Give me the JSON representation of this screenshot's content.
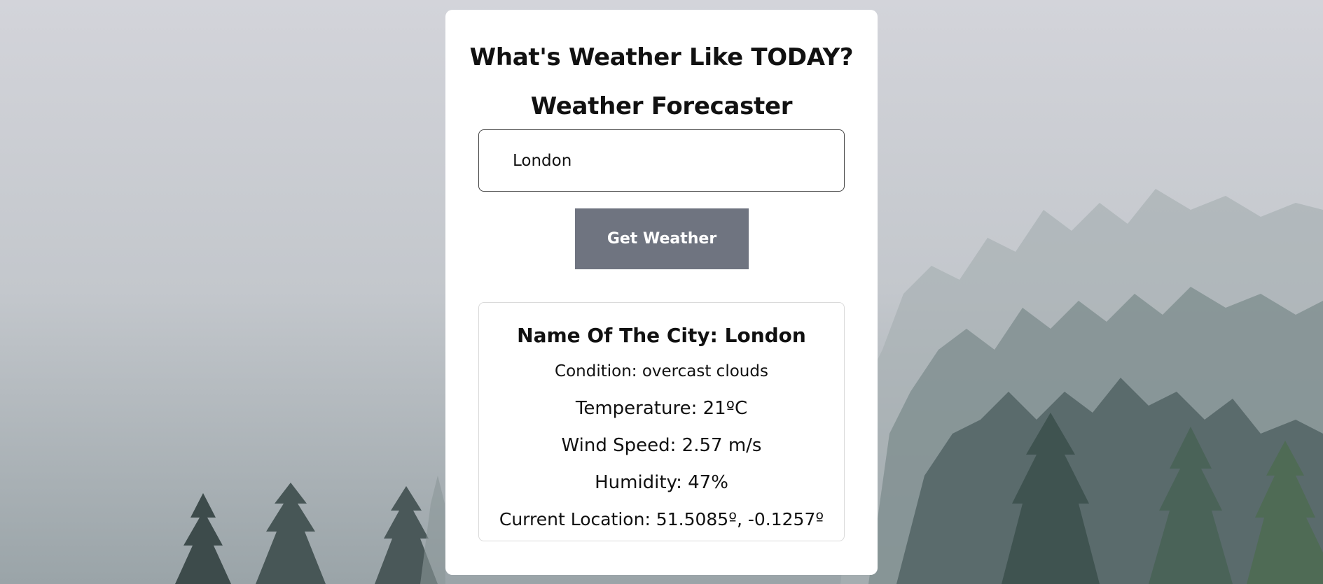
{
  "page": {
    "title": "What's Weather Like TODAY?",
    "subtitle": "Weather Forecaster"
  },
  "search": {
    "value": "London",
    "button_label": "Get Weather"
  },
  "result": {
    "city_line": "Name Of The City: London",
    "condition_line": "Condition: overcast clouds",
    "temperature_line": "Temperature: 21ºC",
    "wind_line": "Wind Speed: 2.57 m/s",
    "humidity_line": "Humidity: 47%",
    "location_line": "Current Location: 51.5085º, -0.1257º"
  },
  "colors": {
    "button": "#6f7480",
    "card": "#ffffff",
    "text": "#111111"
  }
}
